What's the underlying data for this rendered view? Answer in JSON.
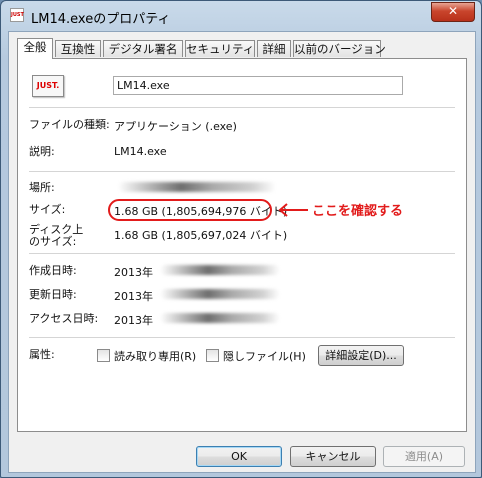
{
  "window": {
    "title": "LM14.exeのプロパティ",
    "close_label": "✕"
  },
  "tabs": [
    {
      "label": "全般"
    },
    {
      "label": "互換性"
    },
    {
      "label": "デジタル署名"
    },
    {
      "label": "セキュリティ"
    },
    {
      "label": "詳細"
    },
    {
      "label": "以前のバージョン"
    }
  ],
  "file": {
    "icon_text": "JUST.",
    "name": "LM14.exe"
  },
  "props": {
    "type_label": "ファイルの種類:",
    "type_value": "アプリケーション (.exe)",
    "desc_label": "説明:",
    "desc_value": "LM14.exe",
    "location_label": "場所:",
    "size_label": "サイズ:",
    "size_value": "1.68 GB (1,805,694,976 バイト)",
    "disk_label_1": "ディスク上",
    "disk_label_2": "のサイズ:",
    "disk_value": "1.68 GB (1,805,697,024 バイト)",
    "created_label": "作成日時:",
    "created_value": "2013年",
    "modified_label": "更新日時:",
    "modified_value": "2013年",
    "accessed_label": "アクセス日時:",
    "accessed_value": "2013年",
    "attr_label": "属性:",
    "readonly_label": "読み取り専用(R)",
    "hidden_label": "隠しファイル(H)",
    "advanced_label": "詳細設定(D)..."
  },
  "annotation": {
    "note": "ここを確認する",
    "color": "#e21b1b"
  },
  "footer": {
    "ok": "OK",
    "cancel": "キャンセル",
    "apply": "適用(A)"
  }
}
